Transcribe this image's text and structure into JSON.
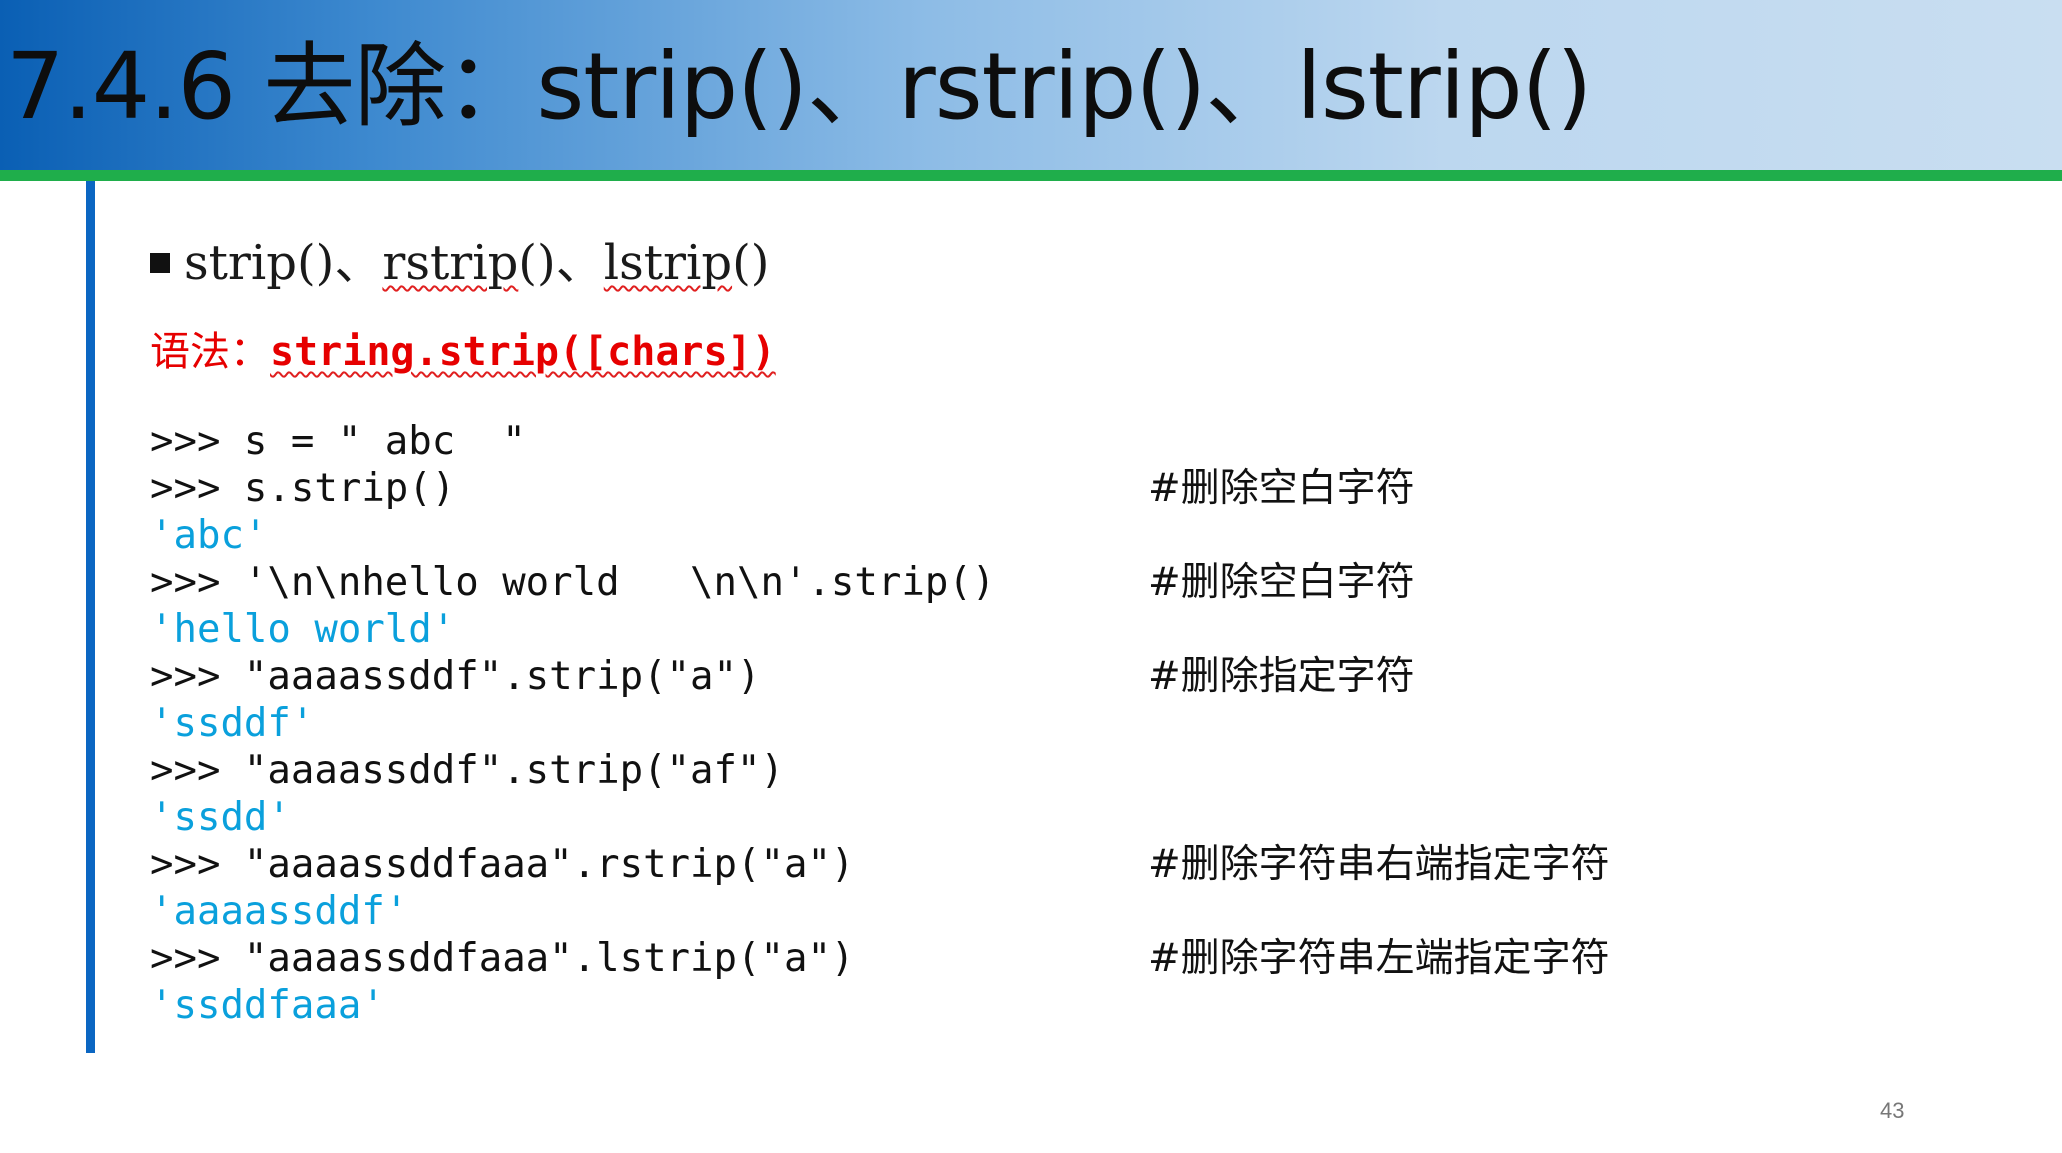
{
  "slide": {
    "title": "7.4.6  去除：strip()、rstrip()、lstrip()",
    "bullet": {
      "p1": "strip()、",
      "p2": "rstrip",
      "p3": "()、",
      "p4": "lstrip",
      "p5": "()"
    },
    "syntax": {
      "label": "语法：",
      "code": "string.strip([chars])"
    },
    "code_lines": [
      {
        "kind": "cmd",
        "text": ">>> s = \" abc  \"",
        "comment": ""
      },
      {
        "kind": "cmd",
        "text": ">>> s.strip()",
        "comment": "#删除空白字符"
      },
      {
        "kind": "out",
        "text": "'abc'",
        "comment": ""
      },
      {
        "kind": "cmd",
        "text": ">>> '\\n\\nhello world   \\n\\n'.strip()",
        "comment": "#删除空白字符"
      },
      {
        "kind": "out",
        "text": "'hello world'",
        "comment": ""
      },
      {
        "kind": "cmd",
        "text": ">>> \"aaaassddf\".strip(\"a\")",
        "comment": "#删除指定字符"
      },
      {
        "kind": "out",
        "text": "'ssddf'",
        "comment": ""
      },
      {
        "kind": "cmd",
        "text": ">>> \"aaaassddf\".strip(\"af\")",
        "comment": ""
      },
      {
        "kind": "out",
        "text": "'ssdd'",
        "comment": ""
      },
      {
        "kind": "cmd",
        "text": ">>> \"aaaassddfaaa\".rstrip(\"a\")",
        "comment": "#删除字符串右端指定字符"
      },
      {
        "kind": "out",
        "text": "'aaaassddf'",
        "comment": ""
      },
      {
        "kind": "cmd",
        "text": ">>> \"aaaassddfaaa\".lstrip(\"a\")",
        "comment": "#删除字符串左端指定字符"
      },
      {
        "kind": "out",
        "text": "'ssddfaaa'",
        "comment": ""
      }
    ],
    "page_number": "43"
  }
}
